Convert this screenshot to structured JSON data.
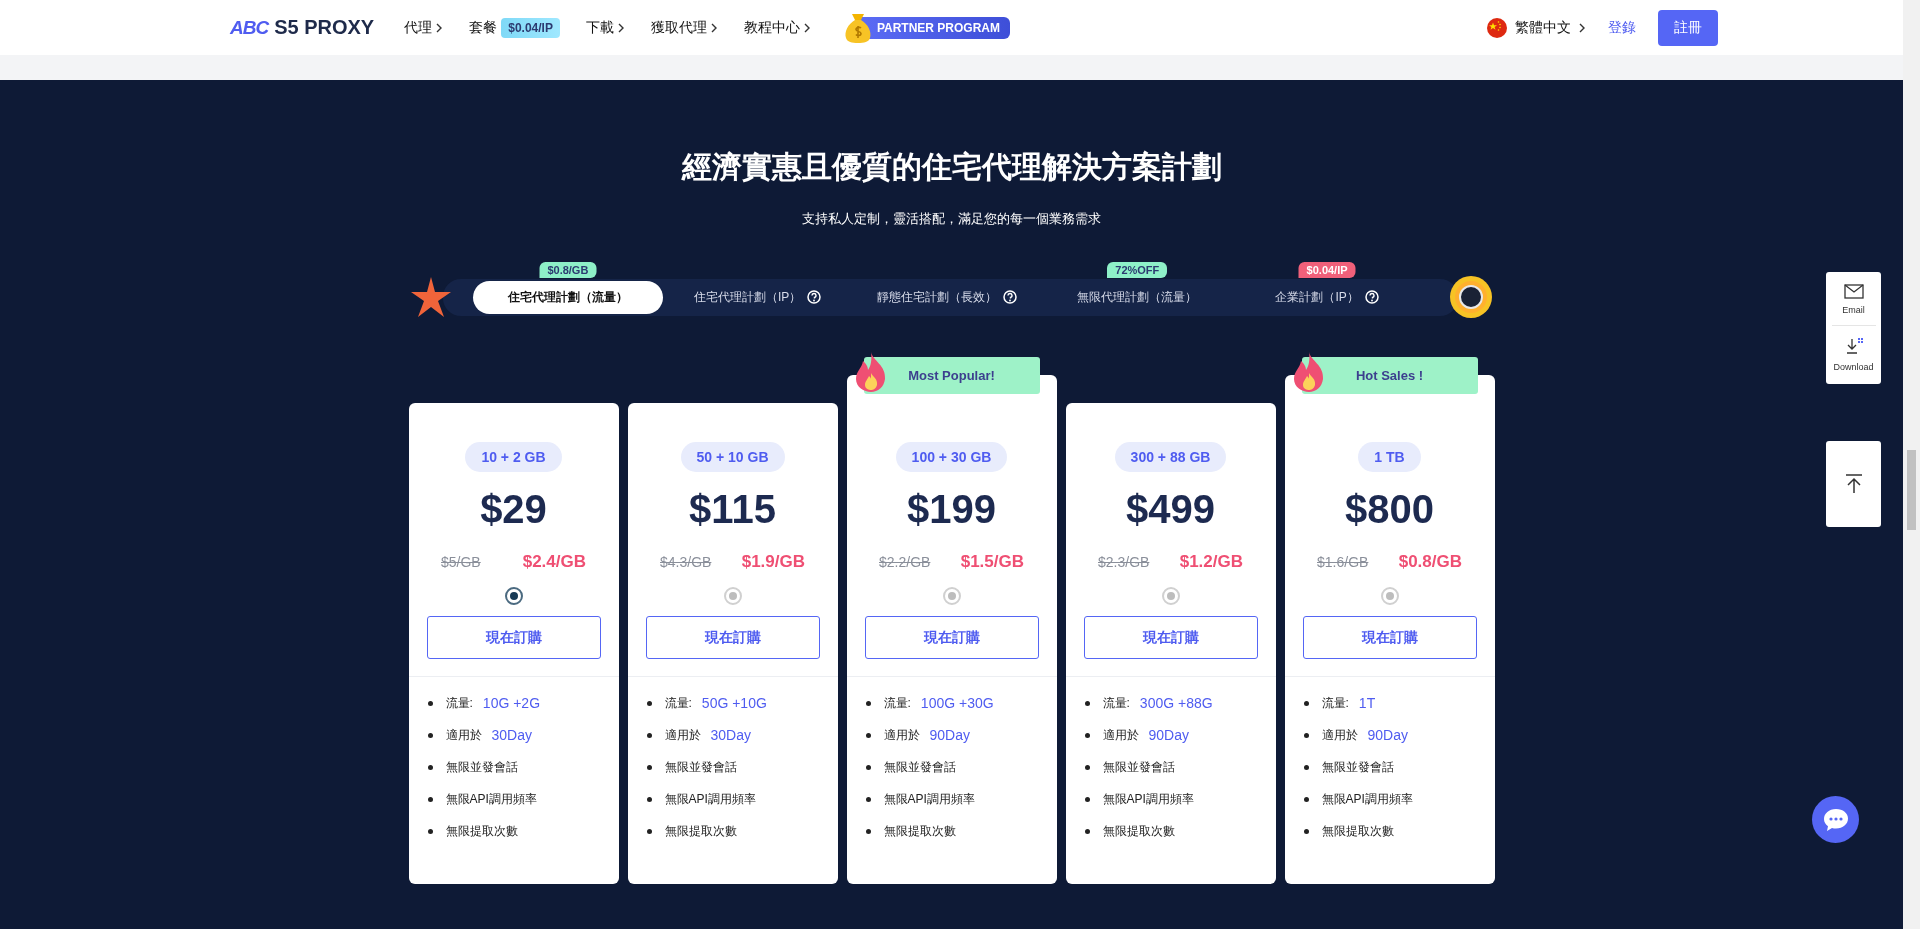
{
  "header": {
    "logo_mark": "ABC",
    "logo_text": "S5 PROXY",
    "nav": [
      {
        "label": "代理",
        "caret": true
      },
      {
        "label": "套餐",
        "badge": "$0.04/IP",
        "caret": false
      },
      {
        "label": "下載",
        "caret": true
      },
      {
        "label": "獲取代理",
        "caret": true
      },
      {
        "label": "教程中心",
        "caret": true
      }
    ],
    "partner": "PARTNER PROGRAM",
    "language": "繁體中文",
    "login": "登錄",
    "register": "註冊"
  },
  "hero": {
    "title": "經濟實惠且優質的住宅代理解決方案計劃",
    "subtitle": "支持私人定制，靈活搭配，滿足您的每一個業務需求"
  },
  "tabs": [
    {
      "label": "住宅代理計劃（流量）",
      "selected": true,
      "help": false,
      "badge": "$0.8/GB",
      "color": "#8ef0c8"
    },
    {
      "label": "住宅代理計劃（IP）",
      "selected": false,
      "help": true
    },
    {
      "label": "靜態住宅計劃（長效）",
      "selected": false,
      "help": true
    },
    {
      "label": "無限代理計劃（流量）",
      "selected": false,
      "help": false,
      "badge": "72%OFF",
      "color": "#8ef0c8"
    },
    {
      "label": "企業計劃（IP）",
      "selected": false,
      "help": true,
      "badge": "$0.04/IP",
      "color": "#f0607a"
    }
  ],
  "plans": [
    {
      "size": "10 + 2 GB",
      "price": "$29",
      "old_price": "$5/GB",
      "unit_price": "$2.4/GB",
      "selected": true,
      "button": "現在訂購",
      "features": [
        {
          "label": "流量:",
          "value": "10G +2G"
        },
        {
          "label": "適用於",
          "value": "30Day"
        },
        {
          "label": "無限並發會話"
        },
        {
          "label": "無限API調用頻率"
        },
        {
          "label": "無限提取次數"
        }
      ]
    },
    {
      "size": "50 + 10 GB",
      "price": "$115",
      "old_price": "$4.3/GB",
      "unit_price": "$1.9/GB",
      "selected": false,
      "button": "現在訂購",
      "features": [
        {
          "label": "流量:",
          "value": "50G +10G"
        },
        {
          "label": "適用於",
          "value": "30Day"
        },
        {
          "label": "無限並發會話"
        },
        {
          "label": "無限API調用頻率"
        },
        {
          "label": "無限提取次數"
        }
      ]
    },
    {
      "size": "100 + 30 GB",
      "price": "$199",
      "old_price": "$2.2/GB",
      "unit_price": "$1.5/GB",
      "selected": false,
      "ribbon": "Most Popular!",
      "button": "現在訂購",
      "features": [
        {
          "label": "流量:",
          "value": "100G +30G"
        },
        {
          "label": "適用於",
          "value": "90Day"
        },
        {
          "label": "無限並發會話"
        },
        {
          "label": "無限API調用頻率"
        },
        {
          "label": "無限提取次數"
        }
      ]
    },
    {
      "size": "300 + 88 GB",
      "price": "$499",
      "old_price": "$2.3/GB",
      "unit_price": "$1.2/GB",
      "selected": false,
      "button": "現在訂購",
      "features": [
        {
          "label": "流量:",
          "value": "300G +88G"
        },
        {
          "label": "適用於",
          "value": "90Day"
        },
        {
          "label": "無限並發會話"
        },
        {
          "label": "無限API調用頻率"
        },
        {
          "label": "無限提取次數"
        }
      ]
    },
    {
      "size": "1 TB",
      "price": "$800",
      "old_price": "$1.6/GB",
      "unit_price": "$0.8/GB",
      "selected": false,
      "ribbon": "Hot Sales !",
      "button": "現在訂購",
      "features": [
        {
          "label": "流量:",
          "value": "1T"
        },
        {
          "label": "適用於",
          "value": "90Day"
        },
        {
          "label": "無限並發會話"
        },
        {
          "label": "無限API調用頻率"
        },
        {
          "label": "無限提取次數"
        }
      ]
    }
  ],
  "side_widgets": [
    {
      "kind": "email",
      "label": "Email"
    },
    {
      "kind": "download",
      "label": "Download"
    }
  ]
}
